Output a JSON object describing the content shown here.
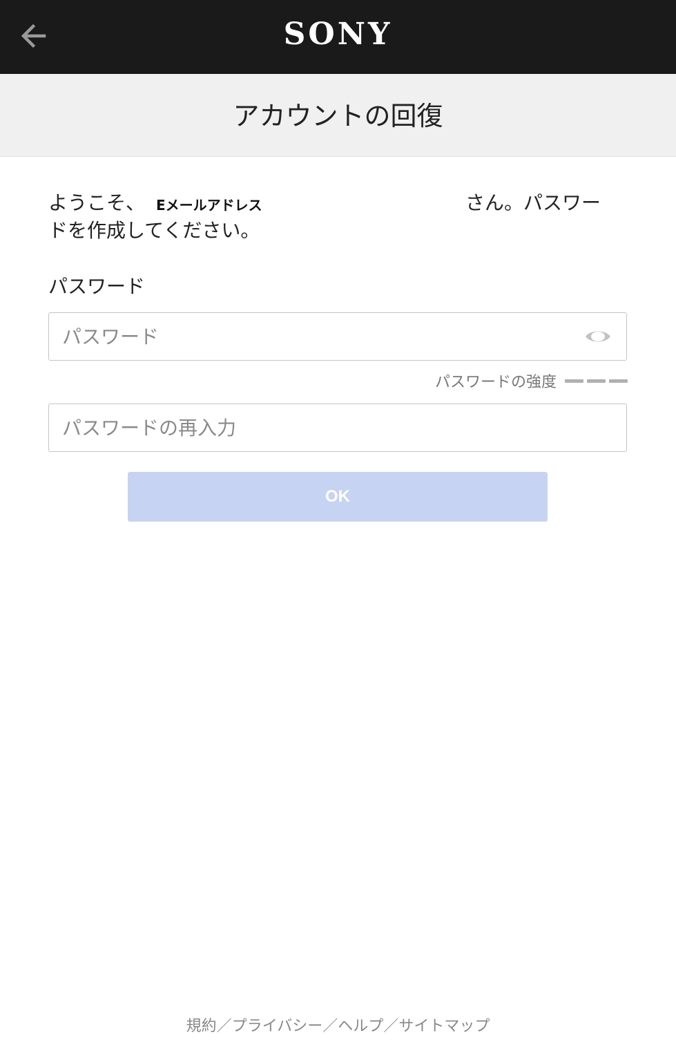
{
  "header": {
    "back_icon": "arrow-left-icon",
    "logo_text": "SONY"
  },
  "title": {
    "text": "アカウントの回復"
  },
  "welcome": {
    "prefix": "ようこそ、",
    "email": "Eメールアドレス",
    "suffix": "さん。パスワー",
    "line2": "ドを作成してください。"
  },
  "password": {
    "label": "パスワード",
    "placeholder": "パスワード",
    "value": "",
    "toggle_icon": "eye-icon",
    "strength_label": "パスワードの強度"
  },
  "confirm": {
    "placeholder": "パスワードの再入力",
    "value": ""
  },
  "ok_button": {
    "label": "OK",
    "color": "#c7d3f2"
  },
  "footer": {
    "terms": "規約",
    "sep1": "／",
    "privacy": "プライバシー",
    "sep2": "／",
    "help": "ヘルプ",
    "sep3": "／",
    "sitemap": "サイトマップ"
  },
  "colors": {
    "header_bg": "#1a1a1a",
    "title_bg": "#f0f0f0",
    "button_disabled": "#c7d3f2"
  }
}
